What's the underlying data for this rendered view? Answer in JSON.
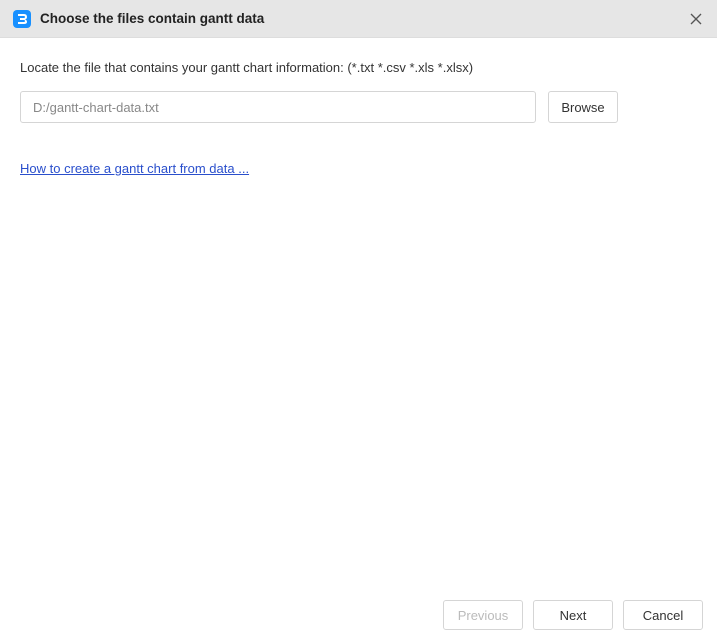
{
  "titlebar": {
    "title": "Choose the files contain gantt data"
  },
  "content": {
    "prompt": "Locate the file that contains your gantt chart information: (*.txt *.csv *.xls *.xlsx)",
    "file_path": "D:/gantt-chart-data.txt",
    "browse_label": "Browse",
    "help_link": "How to create a gantt chart from data ..."
  },
  "footer": {
    "previous_label": "Previous",
    "next_label": "Next",
    "cancel_label": "Cancel"
  }
}
